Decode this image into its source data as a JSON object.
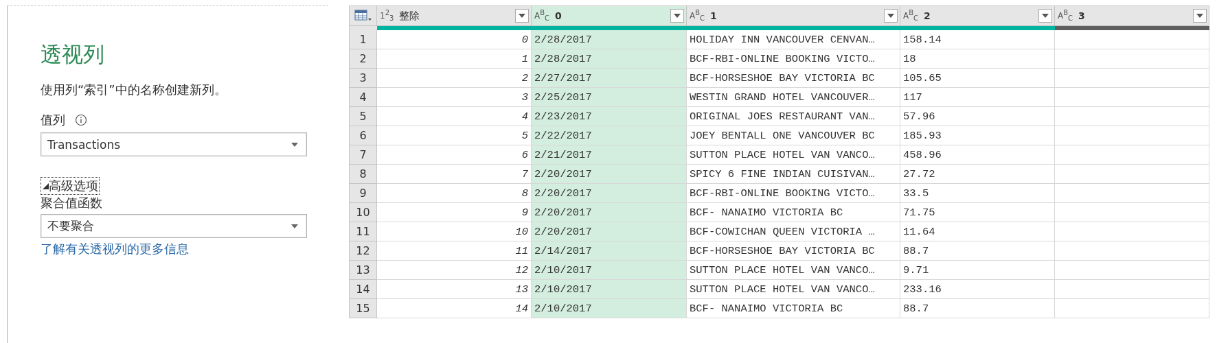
{
  "pivot_panel": {
    "title": "透视列",
    "description": "使用列“索引”中的名称创建新列。",
    "value_column": {
      "label": "值列",
      "value": "Transactions"
    },
    "advanced_options": {
      "label": "高级选项",
      "expanded": true,
      "focused": true
    },
    "aggregate": {
      "label": "聚合值函数",
      "value": "不要聚合"
    },
    "link": "了解有关透视列的更多信息"
  },
  "table": {
    "columns": [
      {
        "type_label": "1$^{2}$$_{3}$",
        "name": "整除",
        "kind": "number",
        "selected": false,
        "color": "#00b4a0"
      },
      {
        "type_label": "A$^{B}$$_{C}$",
        "name": "0",
        "kind": "text",
        "selected": true,
        "color": "#00b4a0"
      },
      {
        "type_label": "A$^{B}$$_{C}$",
        "name": "1",
        "kind": "text",
        "selected": false,
        "color": "#00b4a0"
      },
      {
        "type_label": "A$^{B}$$_{C}$",
        "name": "2",
        "kind": "text",
        "selected": false,
        "color": "#00b4a0"
      },
      {
        "type_label": "A$^{B}$$_{C}$",
        "name": "3",
        "kind": "text",
        "selected": false,
        "color": "#606060"
      }
    ],
    "rows": [
      {
        "number": "1",
        "cells": [
          "0",
          "2/28/2017",
          "HOLIDAY INN VANCOUVER CENVAN…",
          "158.14"
        ]
      },
      {
        "number": "2",
        "cells": [
          "1",
          "2/28/2017",
          "BCF-RBI-ONLINE BOOKING VICTO…",
          "18"
        ]
      },
      {
        "number": "3",
        "cells": [
          "2",
          "2/27/2017",
          "BCF-HORSESHOE BAY VICTORIA BC",
          "105.65"
        ]
      },
      {
        "number": "4",
        "cells": [
          "3",
          "2/25/2017",
          "WESTIN GRAND HOTEL VANCOUVER…",
          "117"
        ]
      },
      {
        "number": "5",
        "cells": [
          "4",
          "2/23/2017",
          "ORIGINAL JOES RESTAURANT VAN…",
          "57.96"
        ]
      },
      {
        "number": "6",
        "cells": [
          "5",
          "2/22/2017",
          "JOEY BENTALL ONE VANCOUVER BC",
          "185.93"
        ]
      },
      {
        "number": "7",
        "cells": [
          "6",
          "2/21/2017",
          "SUTTON PLACE HOTEL VAN VANCO…",
          "458.96"
        ]
      },
      {
        "number": "8",
        "cells": [
          "7",
          "2/20/2017",
          "SPICY 6 FINE INDIAN CUISIVAN…",
          "27.72"
        ]
      },
      {
        "number": "9",
        "cells": [
          "8",
          "2/20/2017",
          "BCF-RBI-ONLINE BOOKING VICTO…",
          "33.5"
        ]
      },
      {
        "number": "10",
        "cells": [
          "9",
          "2/20/2017",
          "BCF- NANAIMO VICTORIA BC",
          "71.75"
        ]
      },
      {
        "number": "11",
        "cells": [
          "10",
          "2/20/2017",
          "BCF-COWICHAN QUEEN VICTORIA …",
          "11.64"
        ]
      },
      {
        "number": "12",
        "cells": [
          "11",
          "2/14/2017",
          "BCF-HORSESHOE BAY VICTORIA BC",
          "88.7"
        ]
      },
      {
        "number": "13",
        "cells": [
          "12",
          "2/10/2017",
          "SUTTON PLACE HOTEL VAN VANCO…",
          "9.71"
        ]
      },
      {
        "number": "14",
        "cells": [
          "13",
          "2/10/2017",
          "SUTTON PLACE HOTEL VAN VANCO…",
          "233.16"
        ]
      },
      {
        "number": "15",
        "cells": [
          "14",
          "2/10/2017",
          "BCF- NANAIMO VICTORIA BC",
          "88.7"
        ]
      }
    ]
  }
}
